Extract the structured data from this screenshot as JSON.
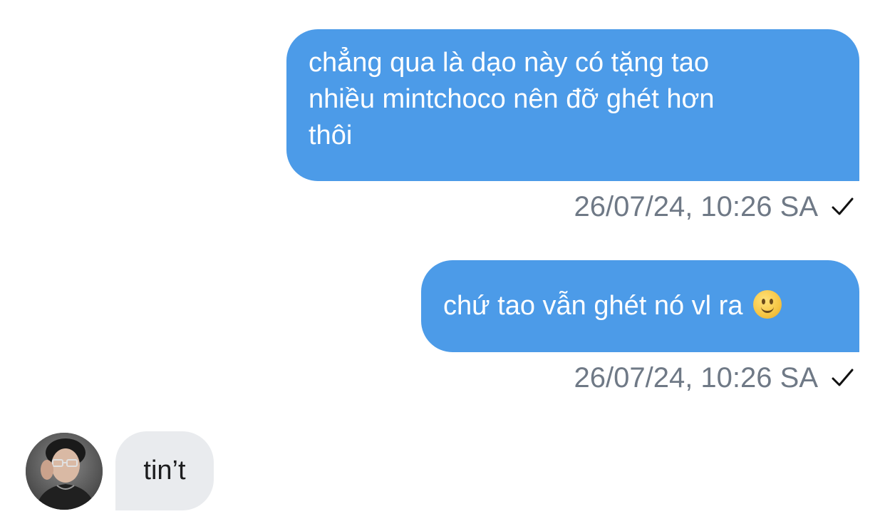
{
  "conversation": {
    "messages": [
      {
        "direction": "sent",
        "lines": [
          "chẳng qua là dạo này có tặng tao",
          "nhiều mintchoco nên đỡ ghét hơn",
          "thôi"
        ],
        "timestamp": "26/07/24, 10:26 SA",
        "status_icon": "single-check-icon"
      },
      {
        "direction": "sent",
        "text": "chứ tao vẫn ghét nó vl ra",
        "emoji": "slightly-smiling-face-emoji",
        "timestamp": "26/07/24, 10:26 SA",
        "status_icon": "single-check-icon"
      },
      {
        "direction": "received",
        "text": "tin’t",
        "avatar_icon": "avatar-photo"
      }
    ]
  },
  "colors": {
    "sent_bubble": "#4c9be8",
    "received_bubble": "#e9ebee",
    "timestamp_text": "#6f7986",
    "background": "#ffffff"
  }
}
